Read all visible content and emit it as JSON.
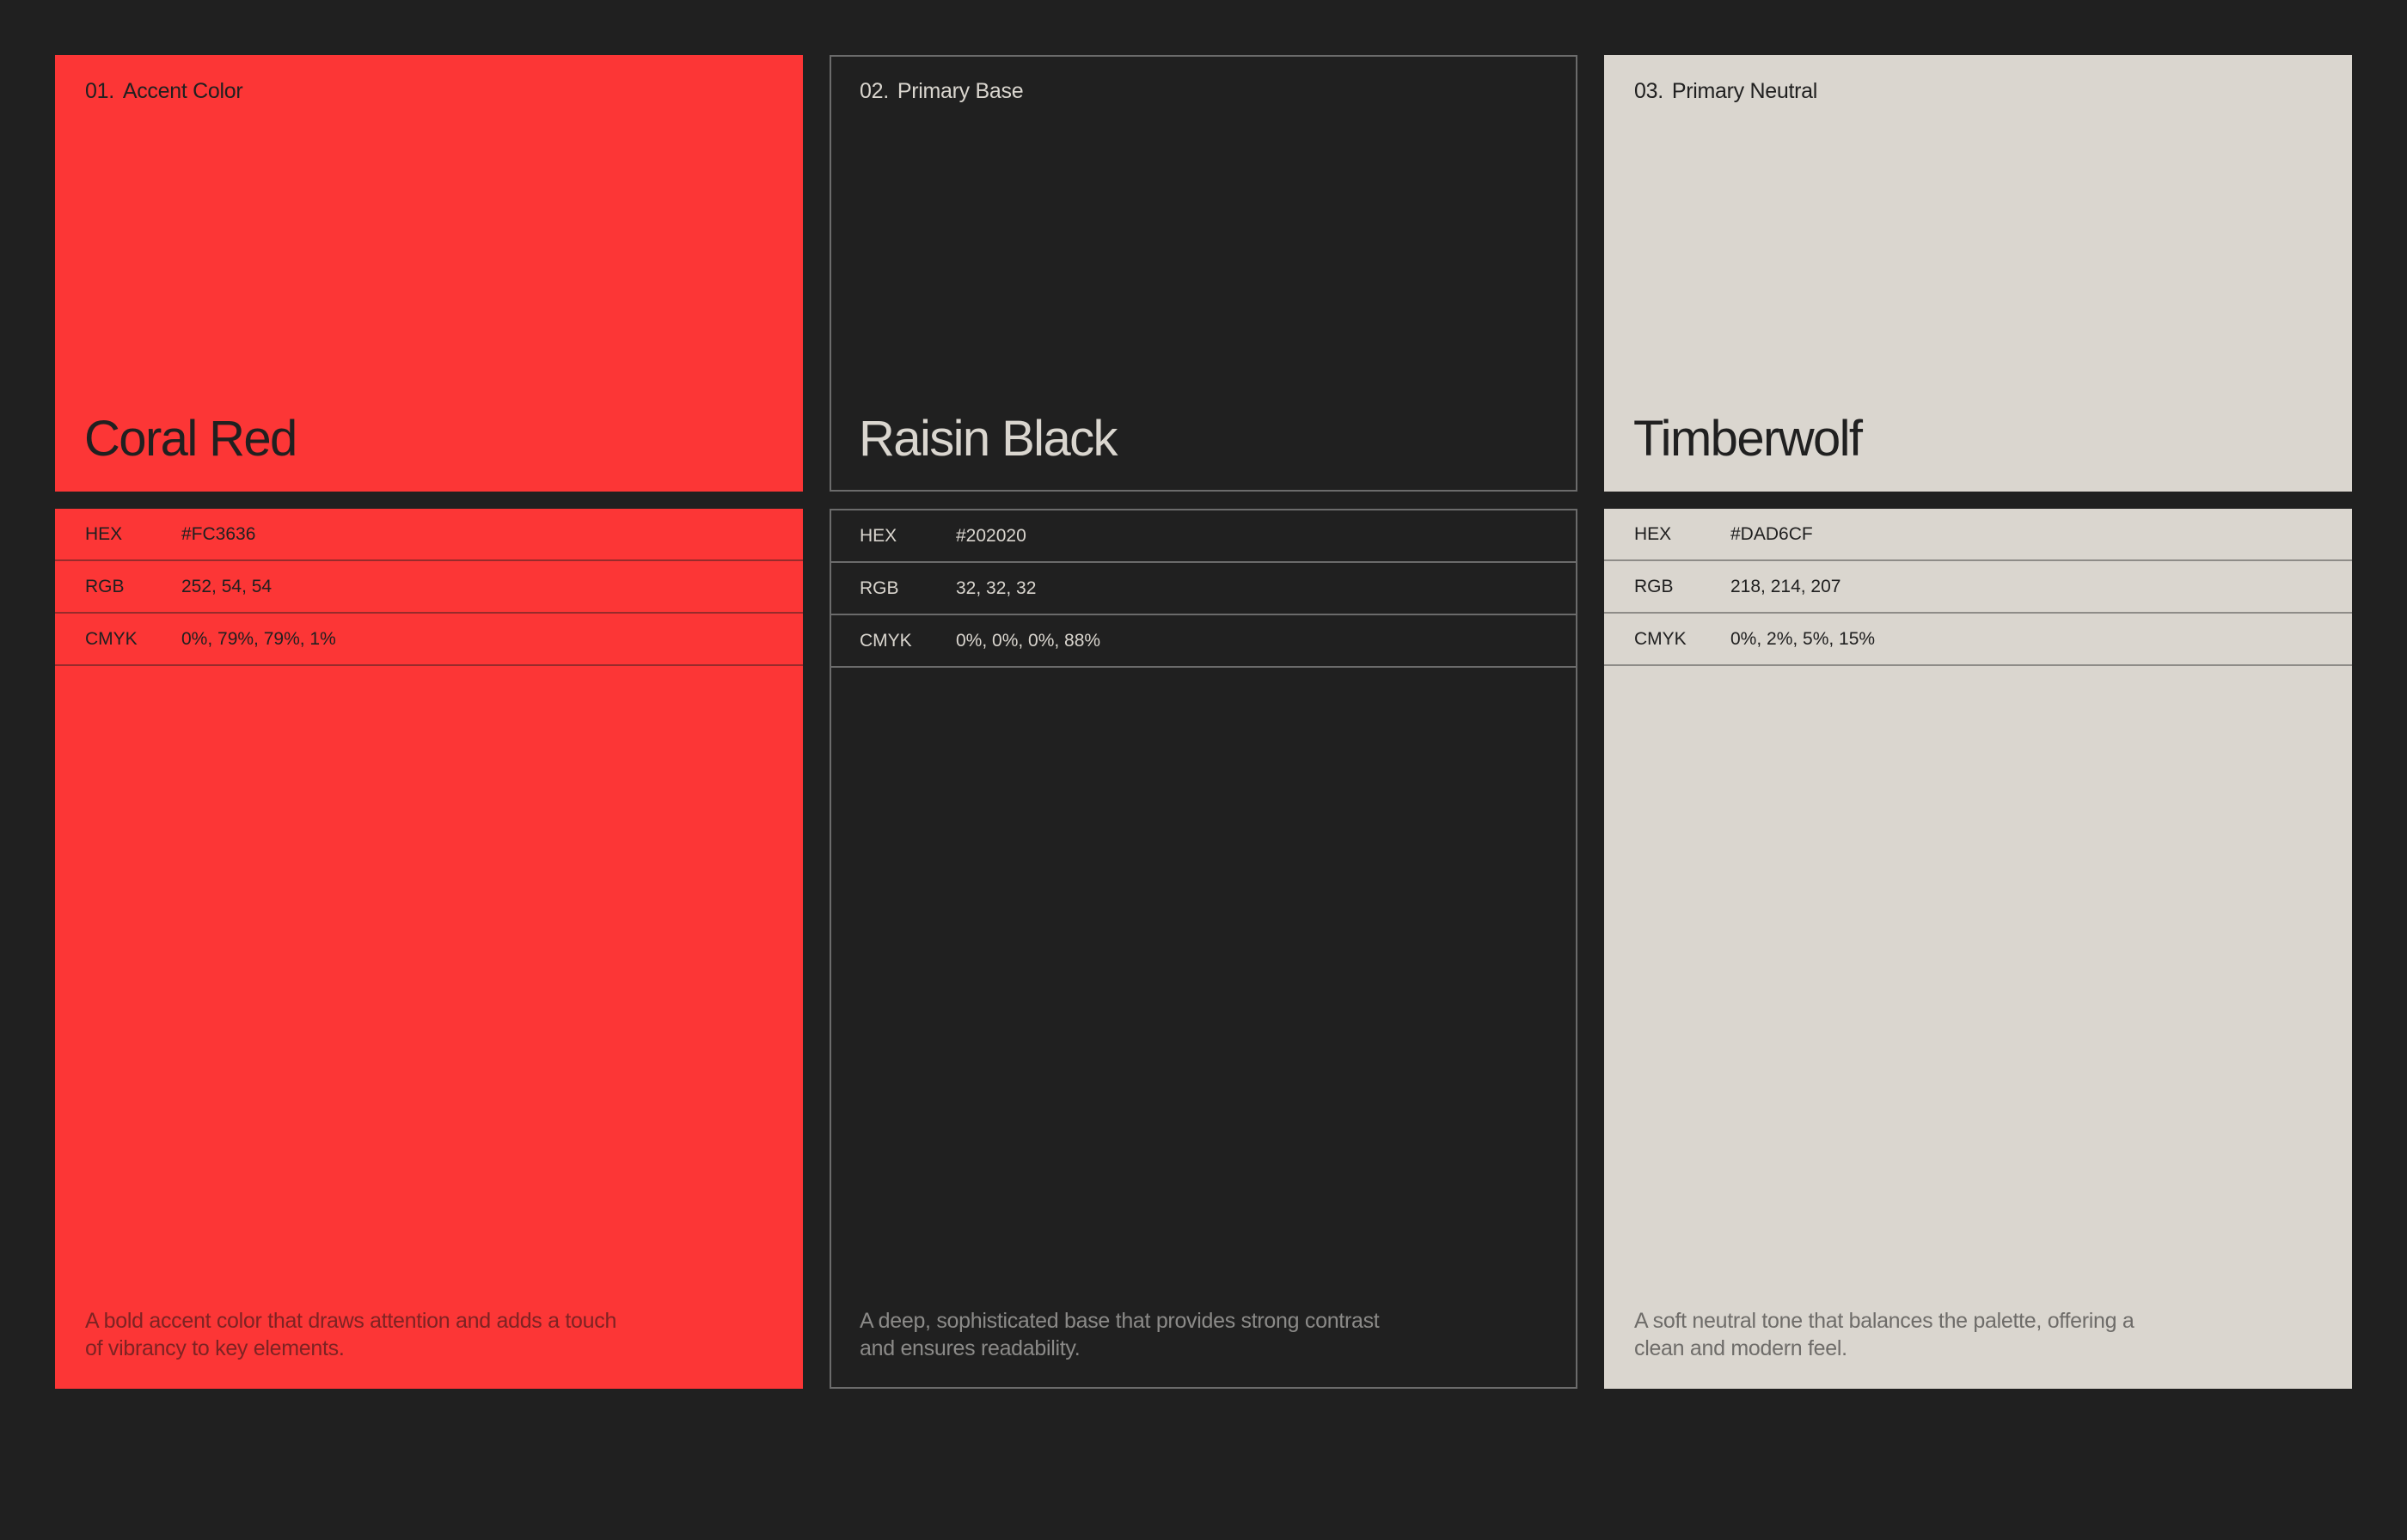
{
  "colors": [
    {
      "number": "01.",
      "role": "Accent Color",
      "name": "Coral Red",
      "specs": [
        {
          "key": "HEX",
          "value": "#FC3636"
        },
        {
          "key": "RGB",
          "value": "252, 54, 54"
        },
        {
          "key": "CMYK",
          "value": "0%, 79%, 79%, 1%"
        }
      ],
      "description": "A bold accent color that draws attention and adds a touch of vibrancy to key elements.",
      "swatch_color": "#FC3636"
    },
    {
      "number": "02.",
      "role": "Primary Base",
      "name": "Raisin Black",
      "specs": [
        {
          "key": "HEX",
          "value": "#202020"
        },
        {
          "key": "RGB",
          "value": "32, 32, 32"
        },
        {
          "key": "CMYK",
          "value": "0%, 0%, 0%, 88%"
        }
      ],
      "description": "A deep, sophisticated base that provides strong contrast and ensures readability.",
      "swatch_color": "#202020"
    },
    {
      "number": "03.",
      "role": "Primary Neutral",
      "name": "Timberwolf",
      "specs": [
        {
          "key": "HEX",
          "value": "#DAD6CF"
        },
        {
          "key": "RGB",
          "value": "218, 214, 207"
        },
        {
          "key": "CMYK",
          "value": "0%, 2%, 5%, 15%"
        }
      ],
      "description": "A soft neutral tone that balances the palette, offering a clean and modern feel.",
      "swatch_color": "#DAD6CF"
    }
  ],
  "page_background": "#202020"
}
